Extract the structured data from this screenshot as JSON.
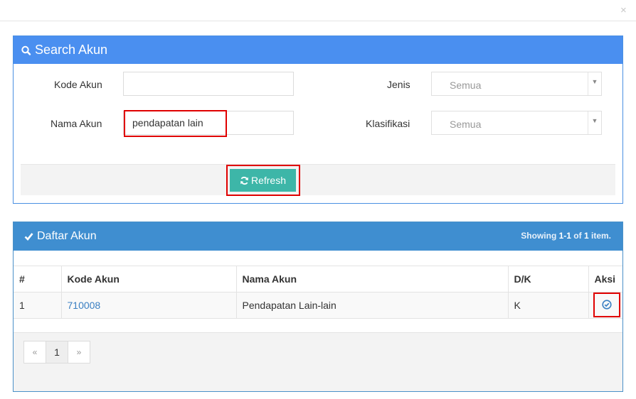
{
  "dialog": {
    "close_label": "×"
  },
  "search": {
    "title": "Search Akun",
    "kode_label": "Kode Akun",
    "kode_value": "",
    "nama_label": "Nama Akun",
    "nama_value": "pendapatan lain",
    "jenis_label": "Jenis",
    "jenis_selected": "Semua",
    "klasifikasi_label": "Klasifikasi",
    "klasifikasi_selected": "Semua",
    "refresh_label": "Refresh",
    "caret": "▼"
  },
  "list": {
    "title": "Daftar Akun",
    "summary_prefix": "Showing ",
    "summary_range": "1-1",
    "summary_mid": " of ",
    "summary_total": "1",
    "summary_suffix": " item.",
    "columns": [
      "#",
      "Kode Akun",
      "Nama Akun",
      "D/K",
      "Aksi"
    ],
    "rows": [
      {
        "no": "1",
        "kode": "710008",
        "nama": "Pendapatan Lain-lain",
        "dk": "K"
      }
    ]
  },
  "pagination": {
    "prev": "«",
    "current": "1",
    "next": "»"
  },
  "colors": {
    "search_header": "#4a8ff0",
    "list_header": "#3f8ed0",
    "refresh_button": "#3db6a8",
    "highlight": "#e00000",
    "link": "#3a7fc2"
  }
}
